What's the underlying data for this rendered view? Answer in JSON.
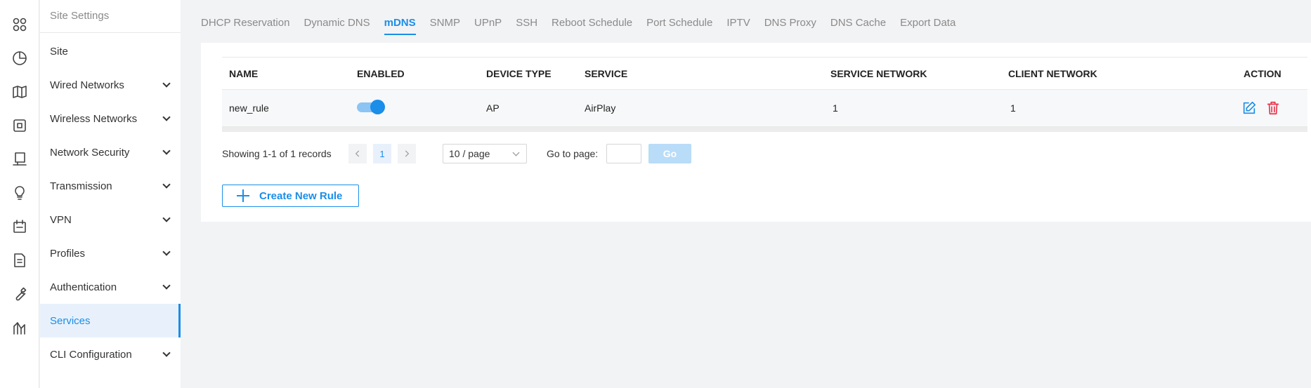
{
  "rail": {
    "icons": [
      "dashboard-icon",
      "statistics-icon",
      "map-icon",
      "device-icon",
      "client-icon",
      "insight-icon",
      "schedule-icon",
      "log-icon",
      "tools-icon",
      "report-icon"
    ]
  },
  "sidebar": {
    "title": "Site Settings",
    "items": [
      {
        "label": "Site"
      },
      {
        "label": "Wired Networks"
      },
      {
        "label": "Wireless Networks"
      },
      {
        "label": "Network Security"
      },
      {
        "label": "Transmission"
      },
      {
        "label": "VPN"
      },
      {
        "label": "Profiles"
      },
      {
        "label": "Authentication"
      },
      {
        "label": "Services"
      },
      {
        "label": "CLI Configuration"
      }
    ]
  },
  "tabs": [
    {
      "label": "DHCP Reservation"
    },
    {
      "label": "Dynamic DNS"
    },
    {
      "label": "mDNS"
    },
    {
      "label": "SNMP"
    },
    {
      "label": "UPnP"
    },
    {
      "label": "SSH"
    },
    {
      "label": "Reboot Schedule"
    },
    {
      "label": "Port Schedule"
    },
    {
      "label": "IPTV"
    },
    {
      "label": "DNS Proxy"
    },
    {
      "label": "DNS Cache"
    },
    {
      "label": "Export Data"
    }
  ],
  "table": {
    "headers": {
      "name": "NAME",
      "enabled": "ENABLED",
      "device_type": "DEVICE TYPE",
      "service": "SERVICE",
      "service_network": "SERVICE NETWORK",
      "client_network": "CLIENT NETWORK",
      "action": "ACTION"
    },
    "rows": [
      {
        "name": "new_rule",
        "enabled": true,
        "device_type": "AP",
        "service": "AirPlay",
        "service_network": "1",
        "client_network": "1"
      }
    ]
  },
  "pagination": {
    "summary": "Showing 1-1 of 1 records",
    "current_page": "1",
    "page_size": "10 / page",
    "goto_label": "Go to page:",
    "go_label": "Go"
  },
  "create_button": {
    "label": "Create New Rule"
  },
  "colors": {
    "accent": "#1a8ee8",
    "danger": "#e8334a",
    "background": "#f2f3f5"
  }
}
